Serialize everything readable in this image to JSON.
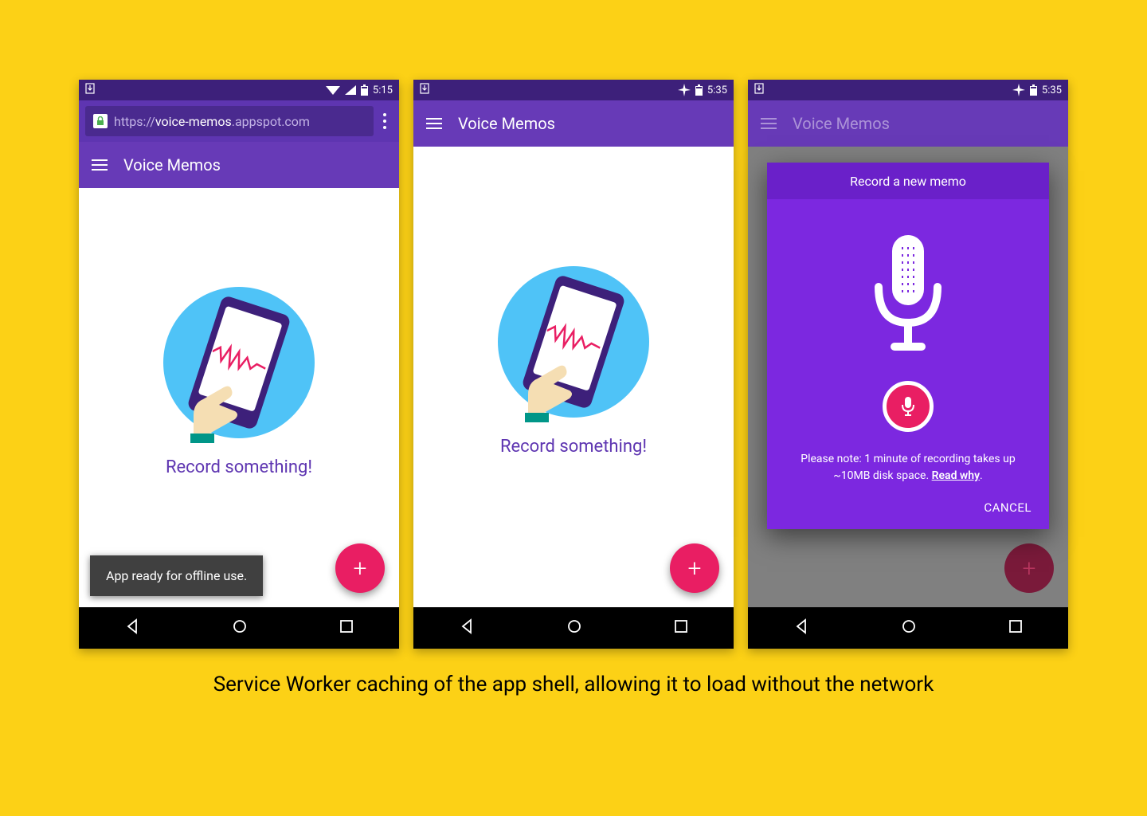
{
  "caption": "Service Worker caching of the app shell, allowing it to load without the network",
  "app": {
    "title": "Voice Memos",
    "url_prefix": "https://",
    "url_domain": "voice-memos",
    "url_suffix": ".appspot.com",
    "record_cta": "Record something!",
    "toast": "App ready for offline use."
  },
  "phone1": {
    "status_time": "5:15",
    "has_url": true,
    "has_wifi": true,
    "has_airplane": false,
    "show_toast": true,
    "dim": false,
    "show_modal": false
  },
  "phone2": {
    "status_time": "5:35",
    "has_url": false,
    "has_wifi": false,
    "has_airplane": true,
    "show_toast": false,
    "dim": false,
    "show_modal": false
  },
  "phone3": {
    "status_time": "5:35",
    "has_url": false,
    "has_wifi": false,
    "has_airplane": true,
    "show_toast": false,
    "dim": true,
    "show_modal": true
  },
  "modal": {
    "title": "Record a new memo",
    "note_prefix": "Please note: 1 minute of recording takes up ~10MB disk space. ",
    "note_link": "Read why",
    "note_suffix": ".",
    "cancel": "CANCEL"
  }
}
